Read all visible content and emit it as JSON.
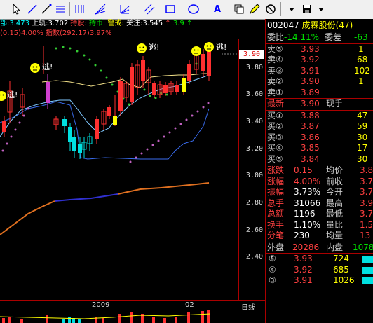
{
  "toolbar": {
    "icons": [
      "cursor-icon",
      "line-icon",
      "ray-icon",
      "parallel-icon",
      "vertical-lines-icon",
      "fan-icon",
      "gann-icon",
      "channel-icon",
      "rectangle-icon",
      "ellipse-icon",
      "text-icon",
      "copy-icon",
      "edit-icon",
      "delete-icon",
      "save-icon"
    ]
  },
  "info_line1": {
    "seg1": "部:3.473",
    "seg2": "上轨:3.702",
    "seg3": "持股:",
    "seg4": "持币:",
    "seg5": "警戒:",
    "seg6": "关注:3.545",
    "seg7": "↑",
    "seg8": "3.9",
    "seg9": "↑"
  },
  "info_line2": {
    "seg1": "(0.15)4.00%",
    "seg2": "指数(292.17)3.97%"
  },
  "chart": {
    "escape_label": "逃!",
    "y_ticks": [
      "3.80",
      "3.60",
      "3.40",
      "3.20",
      "3.00",
      "2.80",
      "2.60",
      "2.40"
    ],
    "current_price": "3.90",
    "date_labels": [
      "2009",
      "02",
      "日线"
    ]
  },
  "panel": {
    "code": "002047",
    "name": "成霖股份",
    "suffix": "(47)",
    "weibi_label": "委比",
    "weibi_value": "-14.11%",
    "weicha_label": "委差",
    "weicha_value": "-63",
    "sell": [
      {
        "label": "卖⑤",
        "price": "3.93",
        "vol": "1"
      },
      {
        "label": "卖④",
        "price": "3.92",
        "vol": "68"
      },
      {
        "label": "卖③",
        "price": "3.91",
        "vol": "102"
      },
      {
        "label": "卖②",
        "price": "3.90",
        "vol": "1"
      },
      {
        "label": "卖①",
        "price": "3.89",
        "vol": ""
      }
    ],
    "latest_label": "最新",
    "latest_value": "3.90",
    "xianshou_label": "现手",
    "buy": [
      {
        "label": "买①",
        "price": "3.88",
        "vol": "47"
      },
      {
        "label": "买②",
        "price": "3.87",
        "vol": "59"
      },
      {
        "label": "买③",
        "price": "3.86",
        "vol": "30"
      },
      {
        "label": "买④",
        "price": "3.85",
        "vol": "17"
      },
      {
        "label": "买⑤",
        "price": "3.84",
        "vol": "30"
      }
    ],
    "stats": [
      {
        "l1": "涨跌",
        "v1": "0.15",
        "l2": "均价",
        "v2": "3.8",
        "c1": "red"
      },
      {
        "l1": "涨幅",
        "v1": "4.00%",
        "l2": "前收",
        "v2": "3.7",
        "c1": "red"
      },
      {
        "l1": "振幅",
        "v1": "3.73%",
        "l2": "今开",
        "v2": "3.7",
        "c1": "wht"
      },
      {
        "l1": "总手",
        "v1": "31066",
        "l2": "最高",
        "v2": "3.9",
        "c1": "wht"
      },
      {
        "l1": "总额",
        "v1": "1196",
        "l2": "最低",
        "v2": "3.7",
        "c1": "wht"
      },
      {
        "l1": "换手",
        "v1": "1.10%",
        "l2": "量比",
        "v2": "1.5",
        "c1": "wht"
      },
      {
        "l1": "分笔",
        "v1": "230",
        "l2": "均量",
        "v2": "13",
        "c1": "wht"
      }
    ],
    "waipan_label": "外盘",
    "waipan_value": "20286",
    "neipan_label": "内盘",
    "neipan_value": "1078",
    "depth": [
      {
        "n": "⑤",
        "price": "3.93",
        "vol": "724"
      },
      {
        "n": "④",
        "price": "3.92",
        "vol": "685"
      },
      {
        "n": "③",
        "price": "3.91",
        "vol": "1026"
      }
    ]
  }
}
